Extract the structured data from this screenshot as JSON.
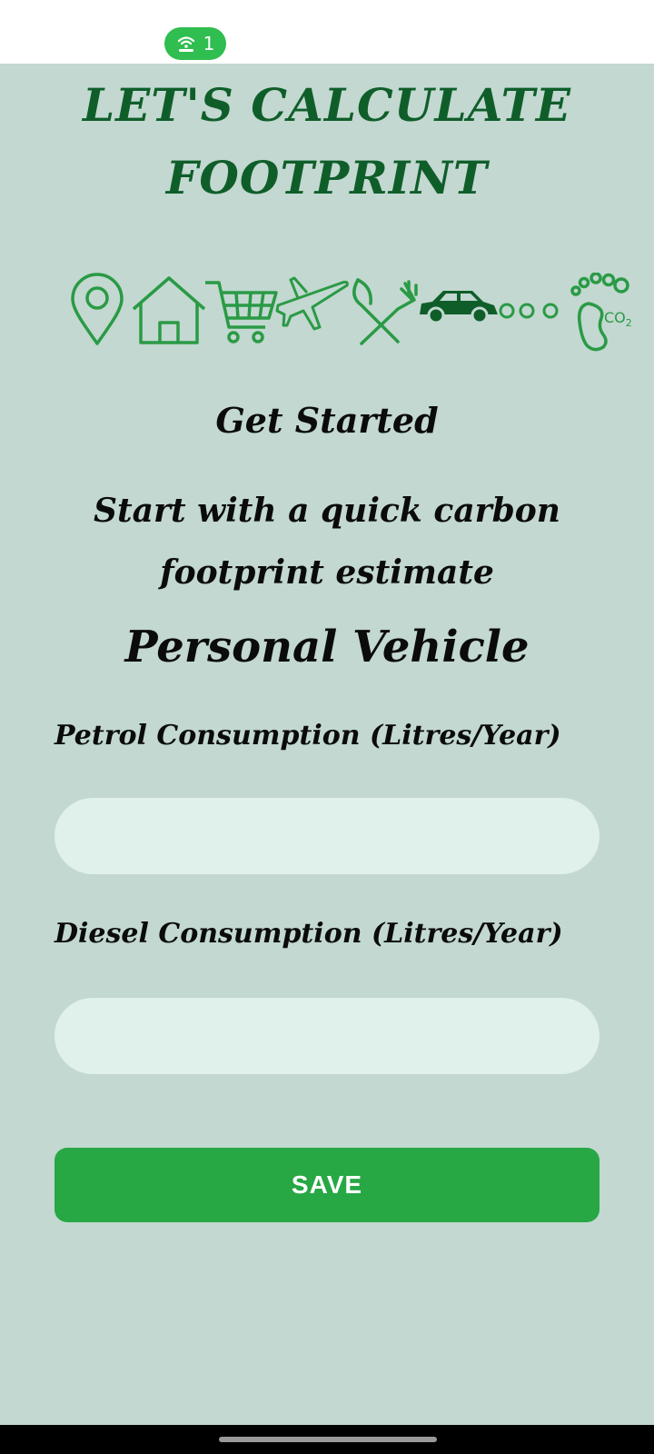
{
  "status_bar": {
    "hotspot_count": "1",
    "hotspot_color": "#2fbe4f"
  },
  "header": {
    "title_line1": "LET'S CALCULATE",
    "title_line2": "FOOTPRINT",
    "title_color": "#0f5e2a"
  },
  "icons": [
    "location-pin-icon",
    "house-icon",
    "shopping-cart-icon",
    "airplane-icon",
    "fork-knife-icon",
    "car-icon",
    "footprint-icon"
  ],
  "footprint_label": "CO",
  "footprint_subscript": "2",
  "intro": {
    "heading": "Get Started",
    "subtitle_line1": "Start with a quick carbon",
    "subtitle_line2": "footprint estimate"
  },
  "section": {
    "heading": "Personal Vehicle"
  },
  "fields": {
    "petrol_label": "Petrol Consumption (Litres/Year)",
    "petrol_value": "",
    "diesel_label": "Diesel Consumption (Litres/Year)",
    "diesel_value": ""
  },
  "actions": {
    "save_label": "SAVE"
  },
  "colors": {
    "background": "#c2d8d0",
    "input_bg": "#dff1ea",
    "button_bg": "#28a745",
    "icon_green": "#2a9a45",
    "car_green": "#0f5e2a"
  }
}
